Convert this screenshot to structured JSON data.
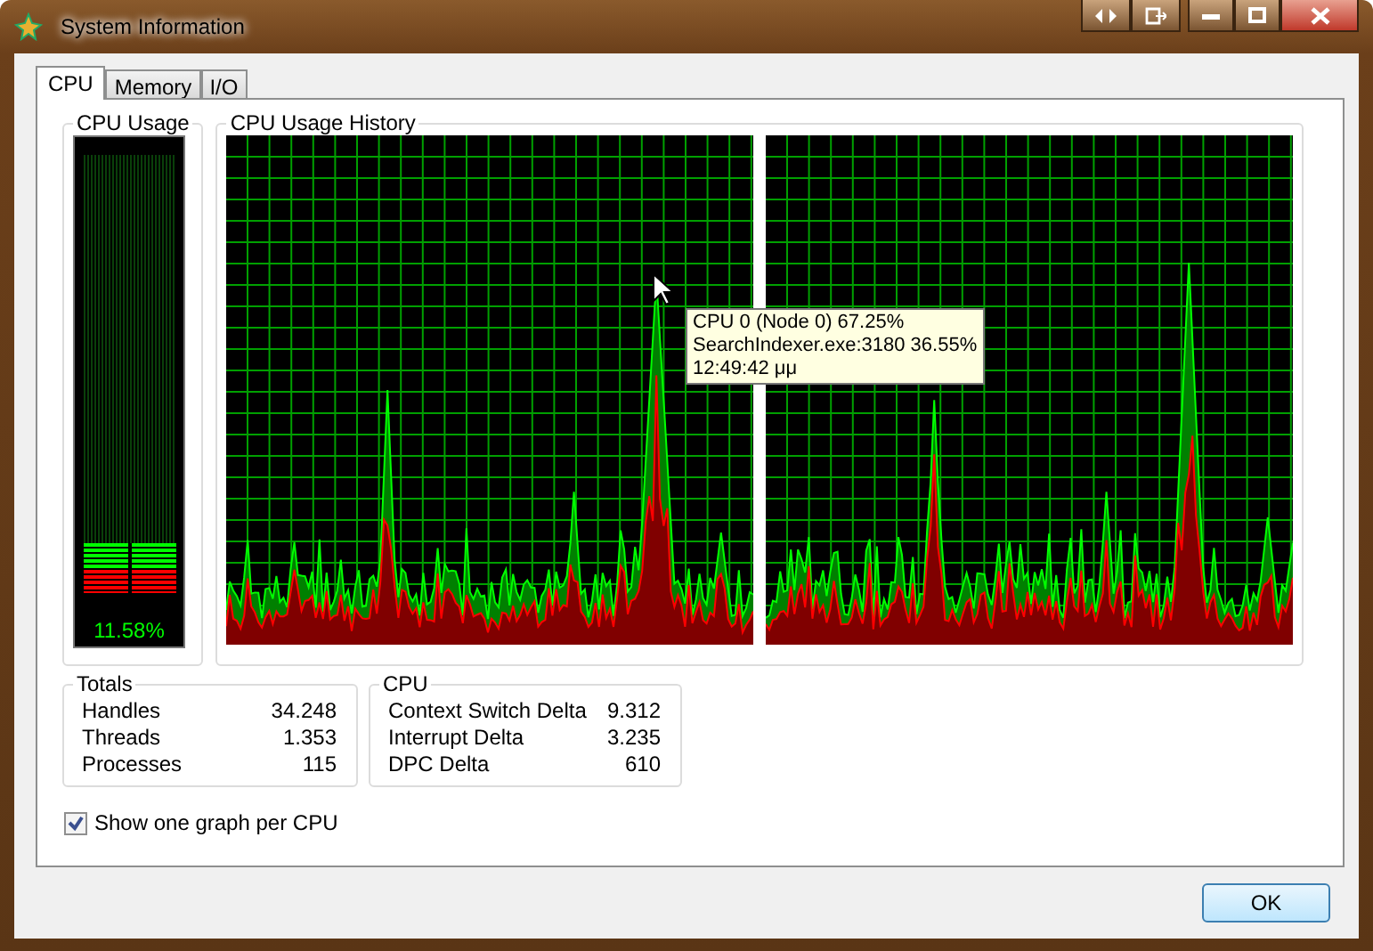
{
  "window": {
    "title": "System Information"
  },
  "tabs": [
    {
      "label": "CPU",
      "selected": true
    },
    {
      "label": "Memory",
      "selected": false
    },
    {
      "label": "I/O",
      "selected": false
    }
  ],
  "cpu_usage": {
    "title": "CPU Usage",
    "level": 0.1158,
    "reading": "11.58%"
  },
  "history": {
    "title": "CPU Usage History",
    "tooltip": [
      "CPU 0 (Node 0) 67.25%",
      "SearchIndexer.exe:3180 36.55%",
      "12:49:42 μμ"
    ]
  },
  "totals": {
    "title": "Totals",
    "rows": [
      {
        "label": "Handles",
        "value": "34.248"
      },
      {
        "label": "Threads",
        "value": "1.353"
      },
      {
        "label": "Processes",
        "value": "115"
      }
    ]
  },
  "cpu": {
    "title": "CPU",
    "rows": [
      {
        "label": "Context Switch Delta",
        "value": "9.312"
      },
      {
        "label": "Interrupt Delta",
        "value": "3.235"
      },
      {
        "label": "DPC Delta",
        "value": "610"
      }
    ]
  },
  "per_cpu": {
    "label": "Show one graph per CPU",
    "checked": true
  },
  "buttons": [
    "OK"
  ]
}
